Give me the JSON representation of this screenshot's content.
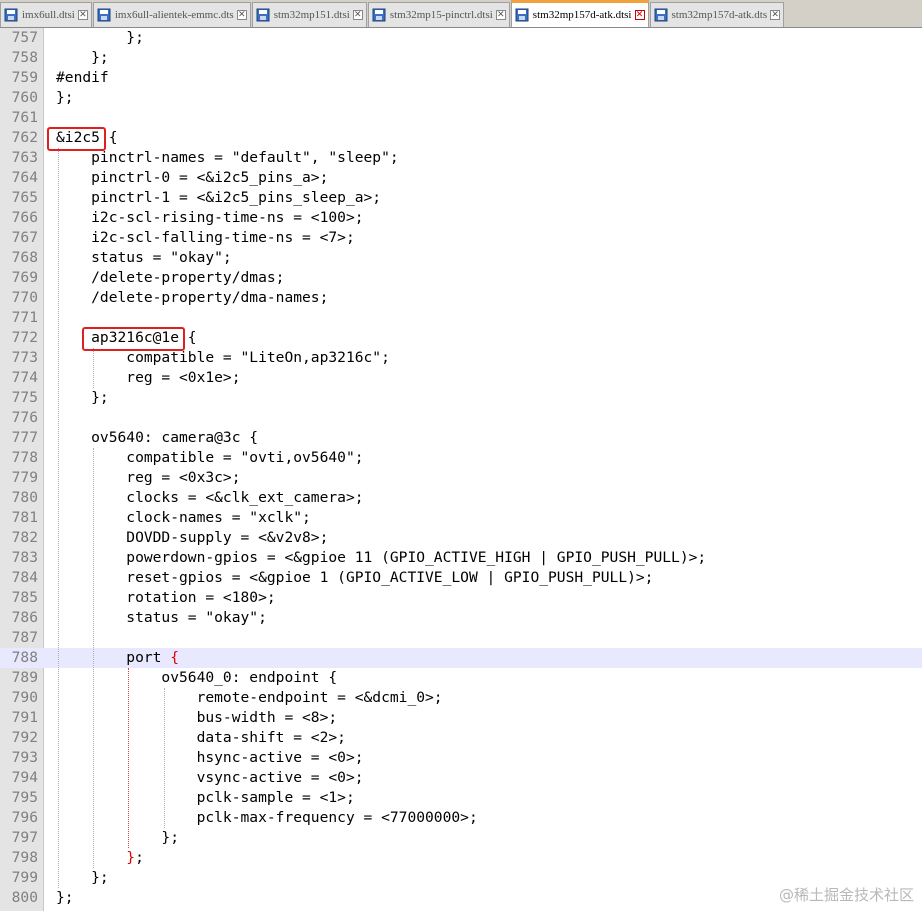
{
  "tabs": [
    {
      "label": "imx6ull.dtsi",
      "active": false
    },
    {
      "label": "imx6ull-alientek-emmc.dts",
      "active": false
    },
    {
      "label": "stm32mp151.dtsi",
      "active": false
    },
    {
      "label": "stm32mp15-pinctrl.dtsi",
      "active": false
    },
    {
      "label": "stm32mp157d-atk.dtsi",
      "active": true
    },
    {
      "label": "stm32mp157d-atk.dts",
      "active": false
    }
  ],
  "editor": {
    "current_line": "788",
    "lines": [
      {
        "num": "757",
        "code": "        };"
      },
      {
        "num": "758",
        "code": "    };"
      },
      {
        "num": "759",
        "code": "#endif"
      },
      {
        "num": "760",
        "code": "};"
      },
      {
        "num": "761",
        "code": ""
      },
      {
        "num": "762",
        "code": "&i2c5 {"
      },
      {
        "num": "763",
        "code": "    pinctrl-names = \"default\", \"sleep\";"
      },
      {
        "num": "764",
        "code": "    pinctrl-0 = <&i2c5_pins_a>;"
      },
      {
        "num": "765",
        "code": "    pinctrl-1 = <&i2c5_pins_sleep_a>;"
      },
      {
        "num": "766",
        "code": "    i2c-scl-rising-time-ns = <100>;"
      },
      {
        "num": "767",
        "code": "    i2c-scl-falling-time-ns = <7>;"
      },
      {
        "num": "768",
        "code": "    status = \"okay\";"
      },
      {
        "num": "769",
        "code": "    /delete-property/dmas;"
      },
      {
        "num": "770",
        "code": "    /delete-property/dma-names;"
      },
      {
        "num": "771",
        "code": ""
      },
      {
        "num": "772",
        "code": "    ap3216c@1e {"
      },
      {
        "num": "773",
        "code": "        compatible = \"LiteOn,ap3216c\";"
      },
      {
        "num": "774",
        "code": "        reg = <0x1e>;"
      },
      {
        "num": "775",
        "code": "    };"
      },
      {
        "num": "776",
        "code": ""
      },
      {
        "num": "777",
        "code": "    ov5640: camera@3c {"
      },
      {
        "num": "778",
        "code": "        compatible = \"ovti,ov5640\";"
      },
      {
        "num": "779",
        "code": "        reg = <0x3c>;"
      },
      {
        "num": "780",
        "code": "        clocks = <&clk_ext_camera>;"
      },
      {
        "num": "781",
        "code": "        clock-names = \"xclk\";"
      },
      {
        "num": "782",
        "code": "        DOVDD-supply = <&v2v8>;"
      },
      {
        "num": "783",
        "code": "        powerdown-gpios = <&gpioe 11 (GPIO_ACTIVE_HIGH | GPIO_PUSH_PULL)>;"
      },
      {
        "num": "784",
        "code": "        reset-gpios = <&gpioe 1 (GPIO_ACTIVE_LOW | GPIO_PUSH_PULL)>;"
      },
      {
        "num": "785",
        "code": "        rotation = <180>;"
      },
      {
        "num": "786",
        "code": "        status = \"okay\";"
      },
      {
        "num": "787",
        "code": ""
      },
      {
        "num": "788",
        "code": "        port {"
      },
      {
        "num": "789",
        "code": "            ov5640_0: endpoint {"
      },
      {
        "num": "790",
        "code": "                remote-endpoint = <&dcmi_0>;"
      },
      {
        "num": "791",
        "code": "                bus-width = <8>;"
      },
      {
        "num": "792",
        "code": "                data-shift = <2>;"
      },
      {
        "num": "793",
        "code": "                hsync-active = <0>;"
      },
      {
        "num": "794",
        "code": "                vsync-active = <0>;"
      },
      {
        "num": "795",
        "code": "                pclk-sample = <1>;"
      },
      {
        "num": "796",
        "code": "                pclk-max-frequency = <77000000>;"
      },
      {
        "num": "797",
        "code": "            };"
      },
      {
        "num": "798",
        "code": "        };"
      },
      {
        "num": "799",
        "code": "    };"
      },
      {
        "num": "800",
        "code": "};"
      }
    ]
  },
  "colors": {
    "accent_tab": "#f0a23c",
    "highlight_box": "#e02020",
    "brace_match": "#e00000",
    "current_line": "#e8e8ff"
  },
  "watermark": "@稀土掘金技术社区"
}
